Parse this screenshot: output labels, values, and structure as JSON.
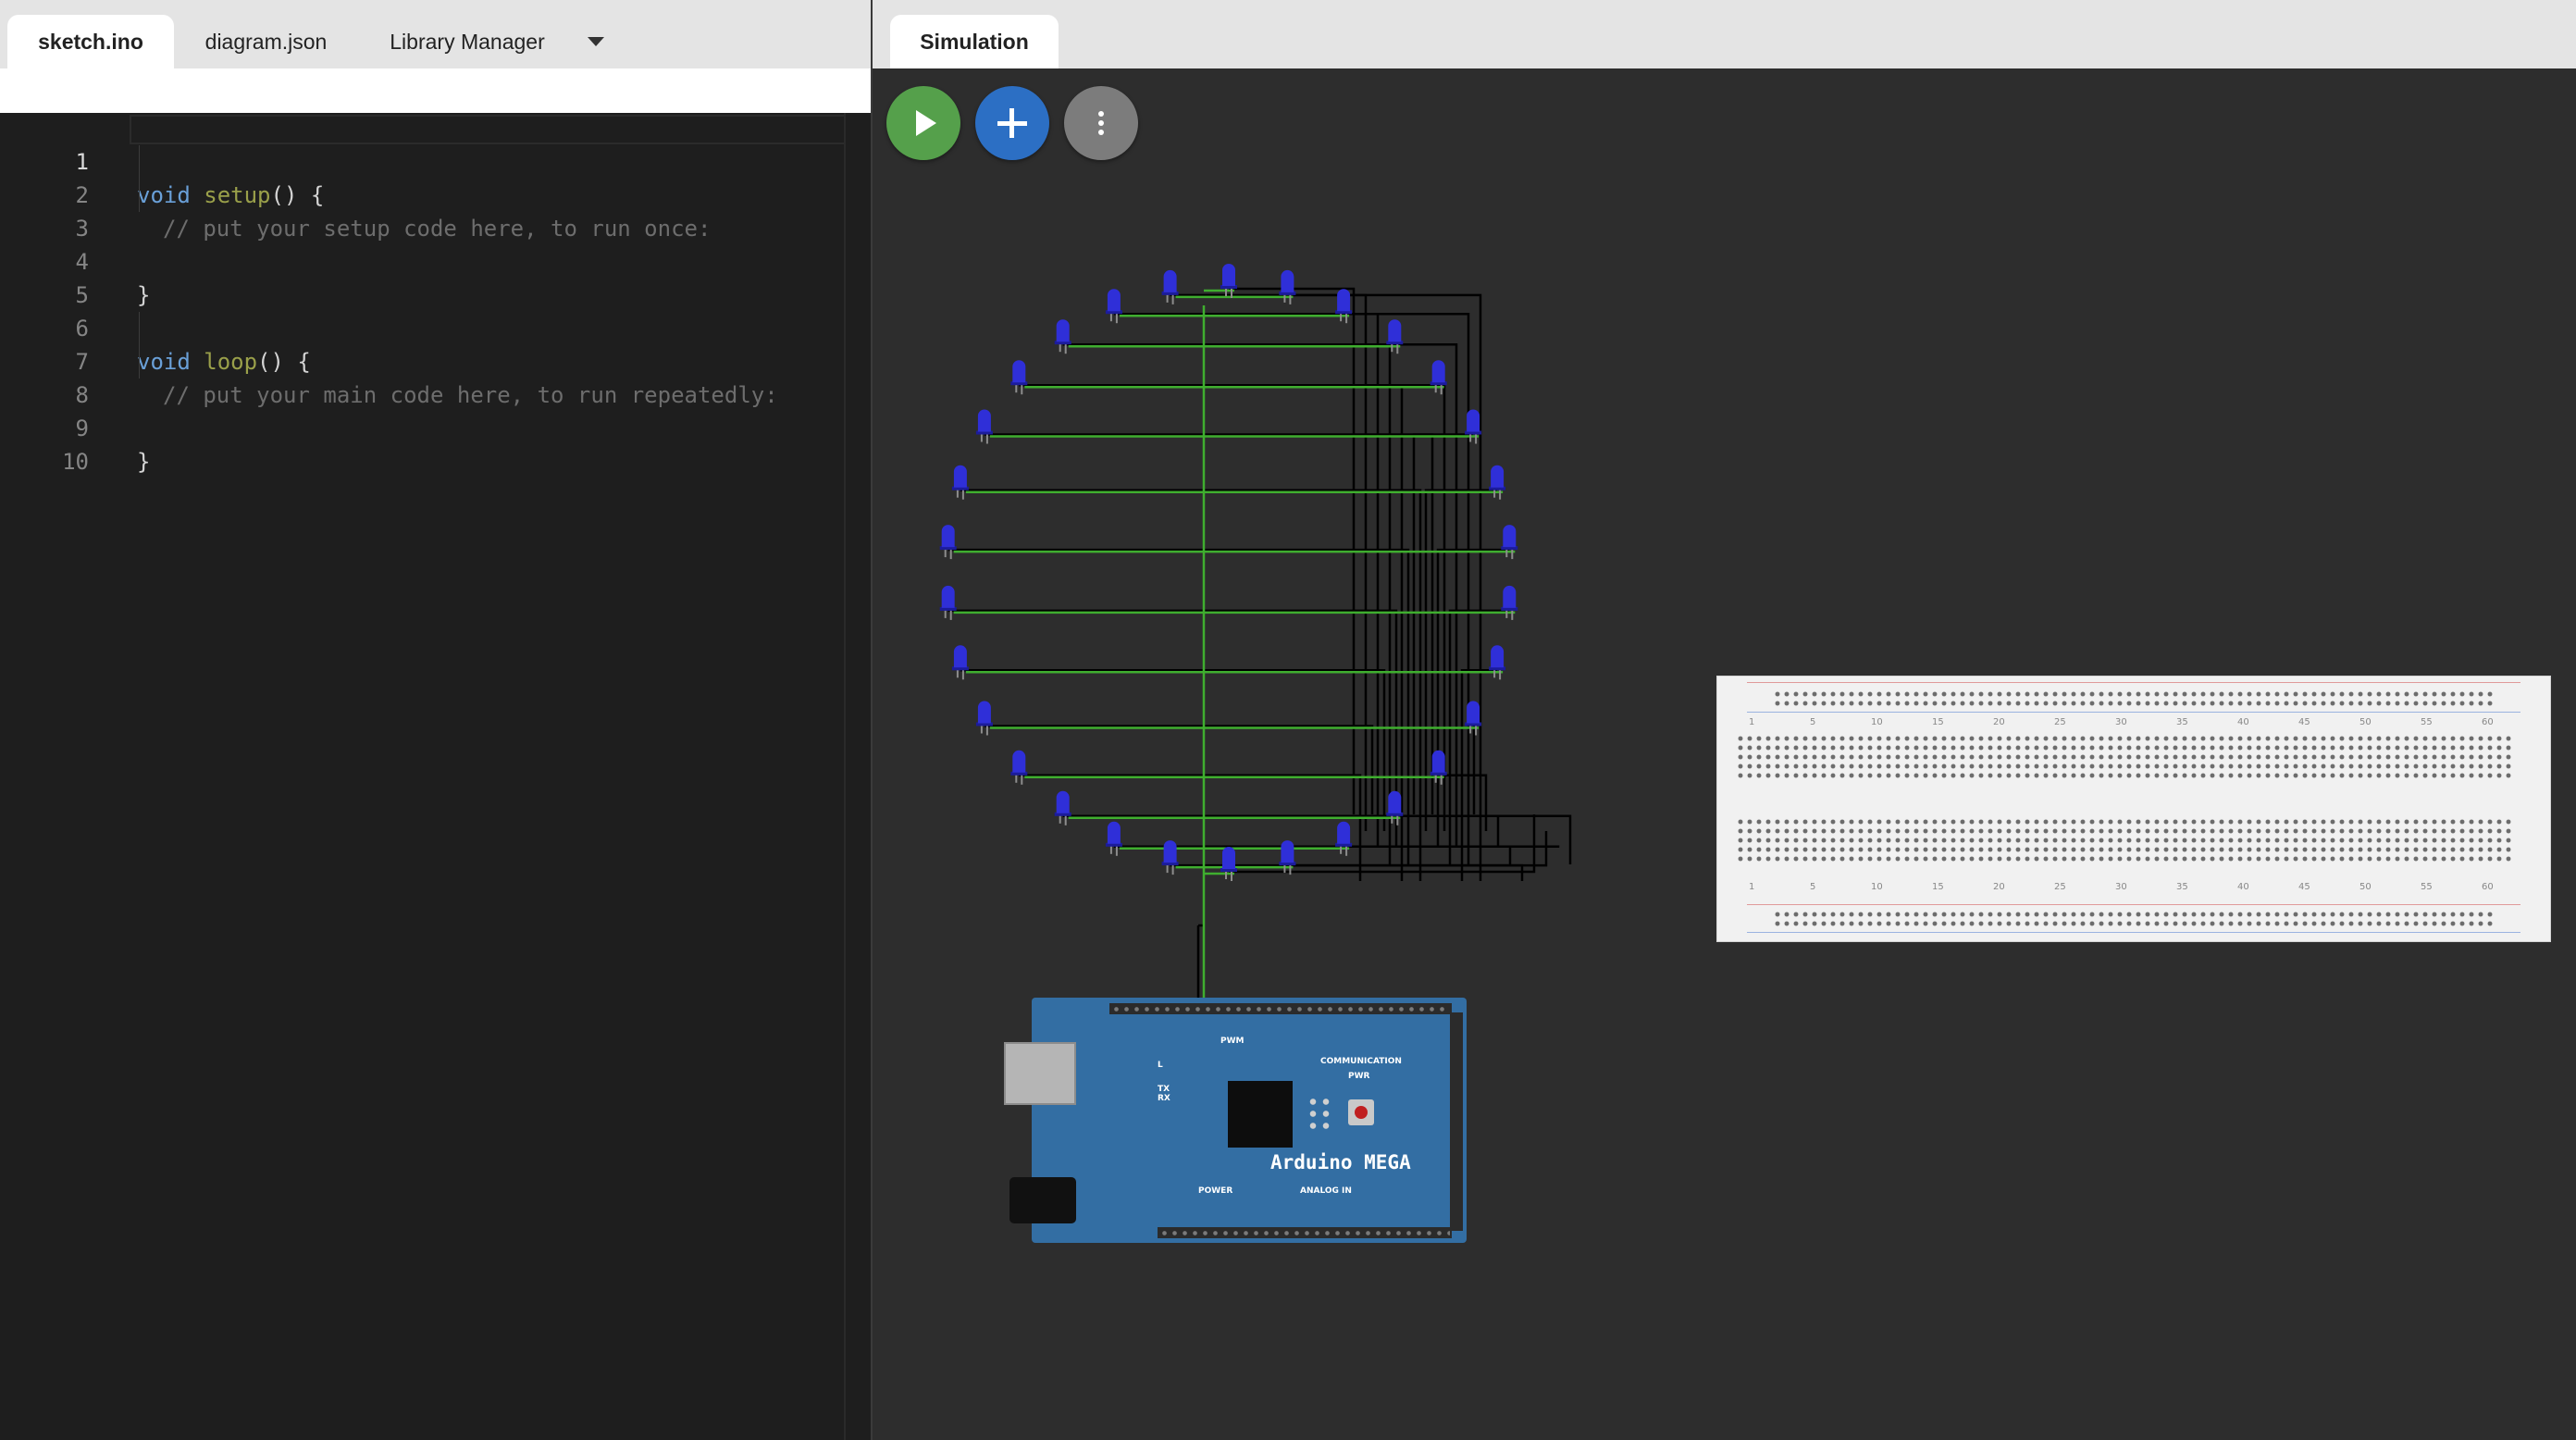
{
  "editor": {
    "tabs": [
      {
        "label": "sketch.ino",
        "active": true
      },
      {
        "label": "diagram.json",
        "active": false
      },
      {
        "label": "Library Manager",
        "active": false
      }
    ],
    "lines": [
      {
        "num": "1",
        "keyword": "void",
        "func": "setup",
        "rest": "() {"
      },
      {
        "num": "2",
        "comment": "// put your setup code here, to run once:"
      },
      {
        "num": "3"
      },
      {
        "num": "4",
        "rest": "}"
      },
      {
        "num": "5"
      },
      {
        "num": "6",
        "keyword": "void",
        "func": "loop",
        "rest": "() {"
      },
      {
        "num": "7",
        "comment": "// put your main code here, to run repeatedly:"
      },
      {
        "num": "8"
      },
      {
        "num": "9",
        "rest": "}"
      },
      {
        "num": "10"
      }
    ]
  },
  "simulation": {
    "tab_label": "Simulation",
    "buttons": {
      "start": "play-icon",
      "add_part": "plus-icon",
      "more": "more-vertical-icon"
    },
    "arduino": {
      "title": "Arduino MEGA",
      "labels": {
        "pwm": "PWM",
        "communication": "COMMUNICATION",
        "power": "POWER",
        "analog": "ANALOG IN",
        "led_l": "L",
        "tx": "TX",
        "rx": "RX",
        "pwr": "PWR"
      }
    },
    "breadboard": {
      "column_numbers": [
        "1",
        "5",
        "10",
        "15",
        "20",
        "25",
        "30",
        "35",
        "40",
        "45",
        "50",
        "55",
        "60"
      ]
    },
    "leds": {
      "count": 30,
      "color": "#2f2fd8"
    }
  },
  "colors": {
    "wire": "#000000",
    "ground_wire": "#3fae2f",
    "led": "#2f2fd8",
    "run": "#55a04b",
    "add": "#2c6fc4",
    "board": "#336ea3"
  }
}
